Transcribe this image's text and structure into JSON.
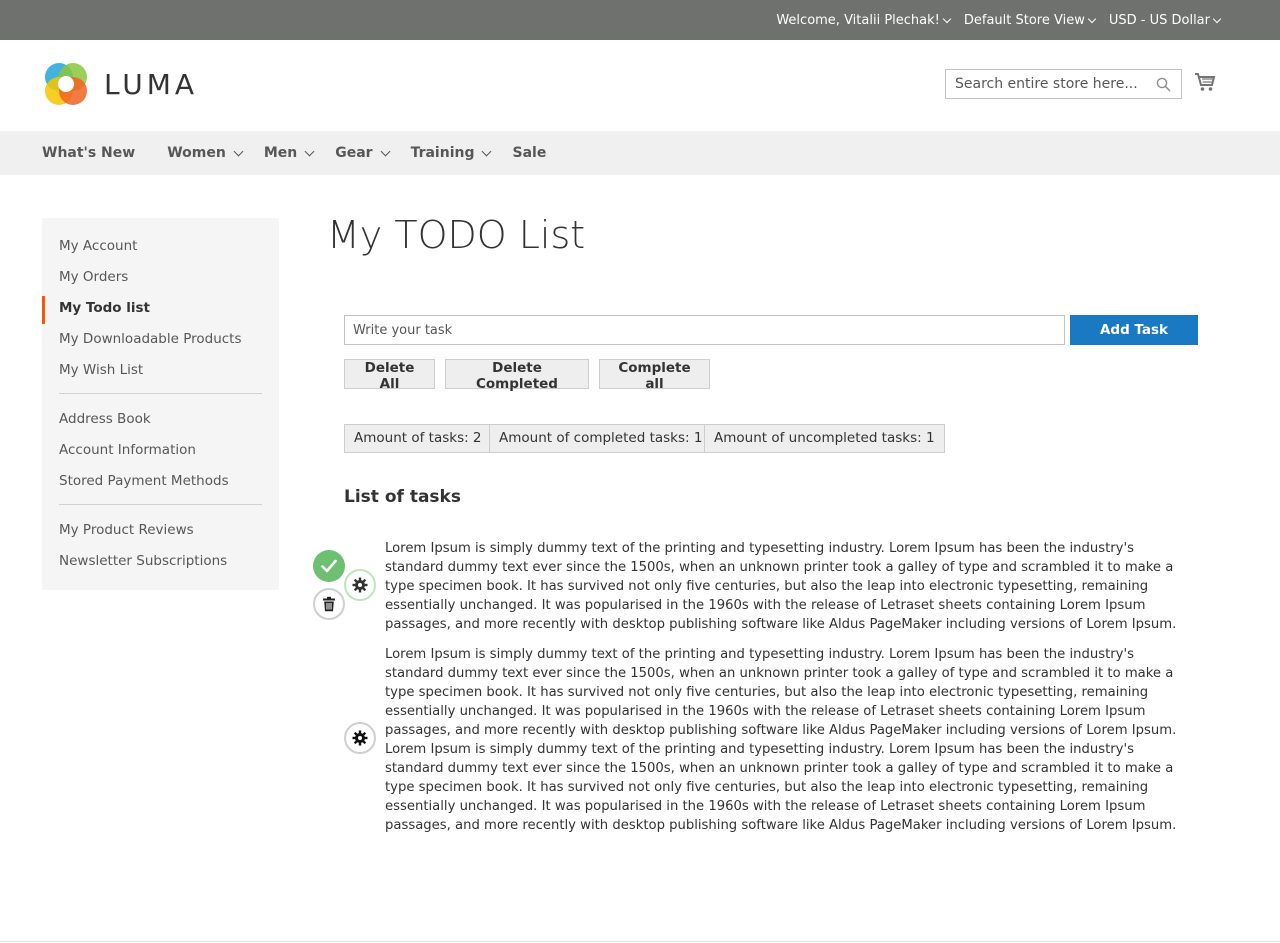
{
  "topbar": {
    "welcome": "Welcome, Vitalii Plechak!",
    "store_view": "Default Store View",
    "currency": "USD - US Dollar"
  },
  "header": {
    "logo_text": "LUMA",
    "search_placeholder": "Search entire store here...",
    "colors": {
      "topbar": "#6e716e",
      "accent": "#1979c3",
      "active_marker": "#ff5501"
    }
  },
  "nav": {
    "items": [
      {
        "label": "What's New",
        "has_dropdown": false
      },
      {
        "label": "Women",
        "has_dropdown": true
      },
      {
        "label": "Men",
        "has_dropdown": true
      },
      {
        "label": "Gear",
        "has_dropdown": true
      },
      {
        "label": "Training",
        "has_dropdown": true
      },
      {
        "label": "Sale",
        "has_dropdown": false
      }
    ]
  },
  "sidebar": {
    "group1": [
      {
        "label": "My Account"
      },
      {
        "label": "My Orders"
      },
      {
        "label": "My Todo list",
        "active": true
      },
      {
        "label": "My Downloadable Products"
      },
      {
        "label": "My Wish List"
      }
    ],
    "group2": [
      {
        "label": "Address Book"
      },
      {
        "label": "Account Information"
      },
      {
        "label": "Stored Payment Methods"
      }
    ],
    "group3": [
      {
        "label": "My Product Reviews"
      },
      {
        "label": "Newsletter Subscriptions"
      }
    ]
  },
  "main": {
    "title": "My TODO List",
    "task_placeholder": "Write your task",
    "add_button": "Add Task",
    "delete_all": "Delete All",
    "delete_completed": "Delete Completed",
    "complete_all": "Complete all",
    "stats": {
      "total": "Amount of tasks: 2",
      "completed": "Amount of completed tasks: 1",
      "uncompleted": "Amount of uncompleted tasks: 1"
    },
    "list_heading": "List of tasks",
    "tasks": [
      {
        "completed": true,
        "text": "Lorem Ipsum is simply dummy text of the printing and typesetting industry. Lorem Ipsum has been the industry's standard dummy text ever since the 1500s, when an unknown printer took a galley of type and scrambled it to make a type specimen book. It has survived not only five centuries, but also the leap into electronic typesetting, remaining essentially unchanged. It was popularised in the 1960s with the release of Letraset sheets containing Lorem Ipsum passages, and more recently with desktop publishing software like Aldus PageMaker including versions of Lorem Ipsum."
      },
      {
        "completed": false,
        "text": "Lorem Ipsum is simply dummy text of the printing and typesetting industry. Lorem Ipsum has been the industry's standard dummy text ever since the 1500s, when an unknown printer took a galley of type and scrambled it to make a type specimen book. It has survived not only five centuries, but also the leap into electronic typesetting, remaining essentially unchanged. It was popularised in the 1960s with the release of Letraset sheets containing Lorem Ipsum passages, and more recently with desktop publishing software like Aldus PageMaker including versions of Lorem Ipsum. Lorem Ipsum is simply dummy text of the printing and typesetting industry. Lorem Ipsum has been the industry's standard dummy text ever since the 1500s, when an unknown printer took a galley of type and scrambled it to make a type specimen book. It has survived not only five centuries, but also the leap into electronic typesetting, remaining essentially unchanged. It was popularised in the 1960s with the release of Letraset sheets containing Lorem Ipsum passages, and more recently with desktop publishing software like Aldus PageMaker including versions of Lorem Ipsum."
      }
    ]
  }
}
